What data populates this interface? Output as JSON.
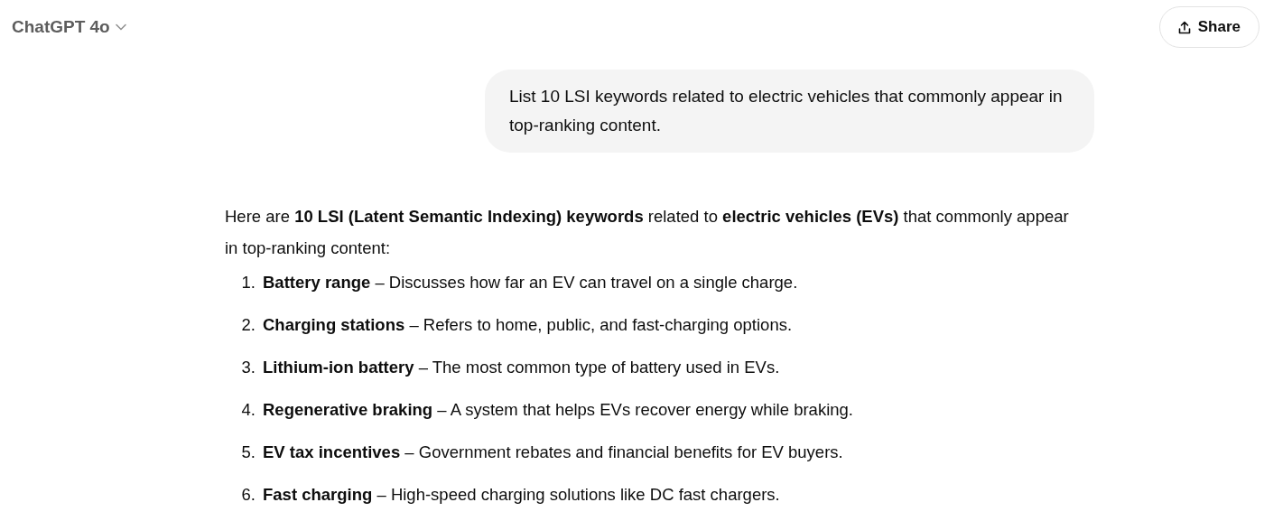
{
  "header": {
    "model": "ChatGPT 4o",
    "share": "Share"
  },
  "user_message": "List 10 LSI keywords related to electric vehicles that commonly appear in top-ranking content.",
  "assistant": {
    "intro": "Here are **10 LSI (Latent Semantic Indexing) keywords** related to **electric vehicles (EVs)** that commonly appear in top-ranking content:",
    "items": [
      {
        "number": "1.",
        "text": "**Battery range** – Discusses how far an EV can travel on a single charge."
      },
      {
        "number": "2.",
        "text": "**Charging stations** – Refers to home, public, and fast-charging options."
      },
      {
        "number": "3.",
        "text": "**Lithium-ion battery** – The most common type of battery used in EVs."
      },
      {
        "number": "4.",
        "text": "**Regenerative braking** – A system that helps EVs recover energy while braking."
      },
      {
        "number": "5.",
        "text": "**EV tax incentives** – Government rebates and financial benefits for EV buyers."
      },
      {
        "number": "6.",
        "text": "**Fast charging** – High-speed charging solutions like DC fast chargers."
      }
    ]
  }
}
